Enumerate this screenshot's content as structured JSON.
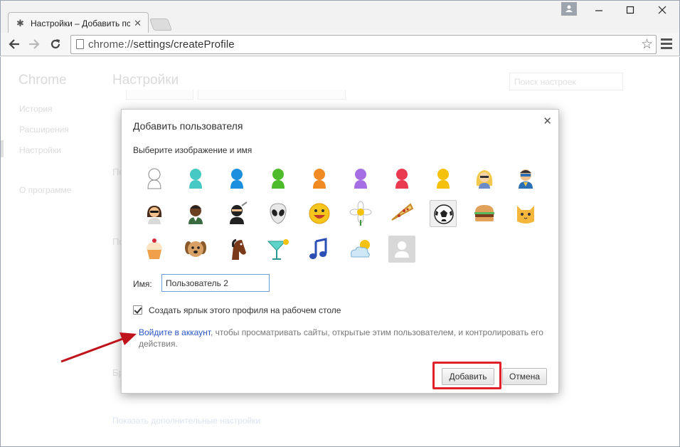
{
  "browser": {
    "tab_title": "Настройки – Добавить пс",
    "tab_icon": "gear-icon",
    "url_scheme": "chrome://",
    "url_path": "settings/createProfile"
  },
  "page": {
    "brand": "Chrome",
    "sidebar": [
      {
        "label": "История"
      },
      {
        "label": "Расширения"
      },
      {
        "label": "Настройки"
      },
      {
        "label": "О программе"
      }
    ],
    "title": "Настройки",
    "search_placeholder": "Поиск настроек",
    "faint_labels": [
      "По",
      "По",
      "Бр"
    ],
    "show_more": "Показать дополнительные настройки"
  },
  "dialog": {
    "title": "Добавить пользователя",
    "subtitle": "Выберите изображение и имя",
    "avatars": [
      "white-silhouette",
      "teal-silhouette",
      "blue-silhouette",
      "green-silhouette",
      "orange-silhouette",
      "purple-silhouette",
      "red-silhouette",
      "yellow-silhouette",
      "blonde-woman",
      "superhero",
      "sunglasses-woman",
      "man",
      "ninja",
      "alien",
      "smiley",
      "flower",
      "pizza",
      "soccer-ball",
      "burger",
      "cat",
      "cupcake",
      "dog",
      "horse",
      "cocktail",
      "music-note",
      "sun-cloud",
      "generic-person"
    ],
    "selected_avatar": "soccer-ball",
    "name_label": "Имя:",
    "name_value": "Пользователь 2",
    "shortcut_label": "Создать ярлык этого профиля на рабочем столе",
    "shortcut_checked": true,
    "info_link": "Войдите в аккаунт",
    "info_text": ", чтобы просматривать сайты, открытые этим пользователем, и контролировать его действия.",
    "add_button": "Добавить",
    "cancel_button": "Отмена"
  },
  "colors": {
    "accent_link": "#2b56c4",
    "highlight": "#e0202a"
  }
}
